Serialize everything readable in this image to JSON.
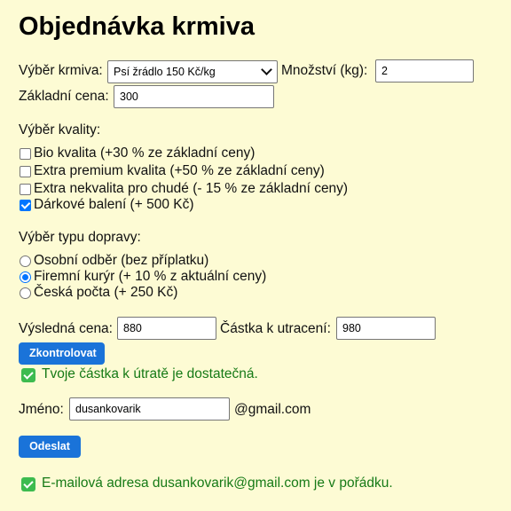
{
  "title": "Objednávka krmiva",
  "feed": {
    "label": "Výběr krmiva:",
    "selected": "Psí žrádlo 150 Kč/kg",
    "quantity_label": "Množství (kg):",
    "quantity_value": "2",
    "base_price_label": "Základní cena:",
    "base_price_value": "300"
  },
  "quality": {
    "heading": "Výběr kvality:",
    "options": [
      {
        "label": "Bio kvalita (+30 % ze základní ceny)",
        "checked": false
      },
      {
        "label": "Extra premium kvalita (+50 % ze základní ceny)",
        "checked": false
      },
      {
        "label": "Extra nekvalita pro chudé (- 15 % ze základní ceny)",
        "checked": false
      },
      {
        "label": "Dárkové balení (+ 500 Kč)",
        "checked": true
      }
    ]
  },
  "delivery": {
    "heading": "Výběr typu dopravy:",
    "options": [
      {
        "label": "Osobní odběr (bez příplatku)",
        "selected": false
      },
      {
        "label": "Firemní kurýr (+ 10 % z aktuální ceny)",
        "selected": true
      },
      {
        "label": "Česká počta (+ 250 Kč)",
        "selected": false
      }
    ]
  },
  "totals": {
    "final_price_label": "Výsledná cena:",
    "final_price_value": "880",
    "budget_label": "Částka k utracení:",
    "budget_value": "980",
    "check_button": "Zkontrolovat",
    "check_message": "Tvoje částka k útratě je dostatečná."
  },
  "email": {
    "name_label": "Jméno:",
    "name_value": "dusankovarik",
    "domain": "@gmail.com",
    "send_button": "Odeslat",
    "message": "E-mailová adresa dusankovarik@gmail.com je v pořádku."
  },
  "colors": {
    "background": "#fdfbd4",
    "button": "#1a73d9",
    "success_text": "#167a16",
    "success_icon": "#3dbb4f",
    "checkbox_accent": "#0075ff"
  },
  "icons": {
    "select_arrow": "chevron-down-icon",
    "success": "check-mark-icon"
  }
}
